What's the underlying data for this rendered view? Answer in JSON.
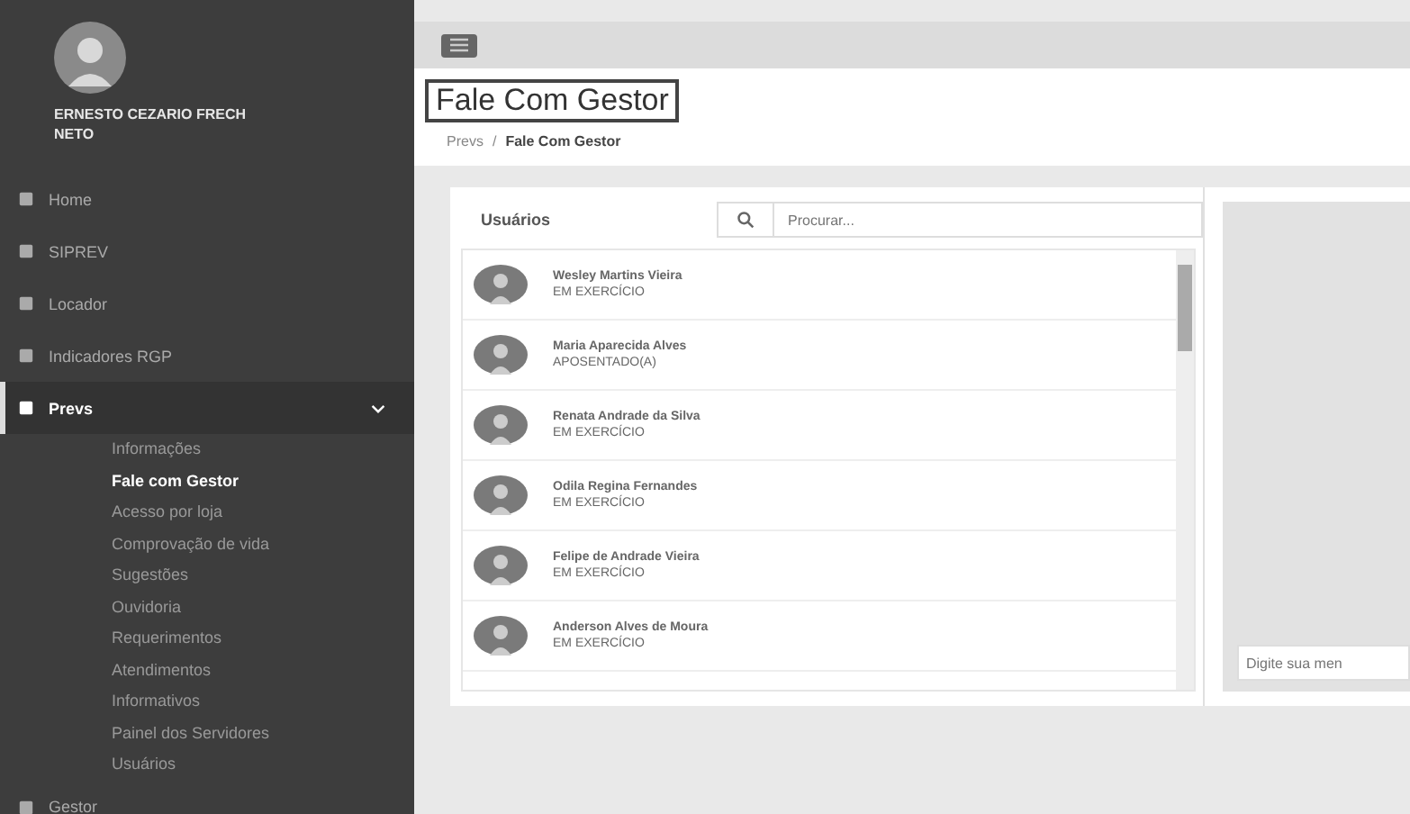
{
  "sidebar": {
    "user": {
      "name": "ERNESTO CEZARIO FRECH NETO"
    },
    "items": [
      {
        "label": "Home",
        "expanded": false
      },
      {
        "label": "SIPREV",
        "expanded": false
      },
      {
        "label": "Locador",
        "expanded": false
      },
      {
        "label": "Indicadores RGP",
        "expanded": false
      },
      {
        "label": "Prevs",
        "expanded": true,
        "children": [
          {
            "label": "Informações",
            "selected": false
          },
          {
            "label": "Fale com Gestor",
            "selected": true
          },
          {
            "label": "Acesso por loja",
            "selected": false
          },
          {
            "label": "Comprovação de vida",
            "selected": false
          },
          {
            "label": "Sugestões",
            "selected": false
          },
          {
            "label": "Ouvidoria",
            "selected": false
          },
          {
            "label": "Requerimentos",
            "selected": false
          },
          {
            "label": "Atendimentos",
            "selected": false
          },
          {
            "label": "Informativos",
            "selected": false
          },
          {
            "label": "Painel dos Servidores",
            "selected": false
          },
          {
            "label": "Usuários",
            "selected": false
          }
        ]
      },
      {
        "label": "Gestor",
        "expanded": false
      }
    ]
  },
  "page": {
    "title": "Fale Com Gestor",
    "breadcrumb": {
      "separator": "/",
      "items": [
        "Prevs",
        "Fale Com Gestor"
      ]
    }
  },
  "users_panel": {
    "title": "Usuários",
    "search": {
      "placeholder": "Procurar..."
    },
    "users": [
      {
        "name": "Wesley Martins Vieira",
        "status": "EM EXERCÍCIO"
      },
      {
        "name": "Maria Aparecida Alves",
        "status": "APOSENTADO(A)"
      },
      {
        "name": "Renata Andrade da Silva",
        "status": "EM EXERCÍCIO"
      },
      {
        "name": "Odila Regina Fernandes",
        "status": "EM EXERCÍCIO"
      },
      {
        "name": "Felipe de Andrade Vieira",
        "status": "EM EXERCÍCIO"
      },
      {
        "name": "Anderson Alves de Moura",
        "status": "EM EXERCÍCIO"
      }
    ]
  },
  "chat": {
    "message": {
      "placeholder": "Digite sua men"
    }
  }
}
